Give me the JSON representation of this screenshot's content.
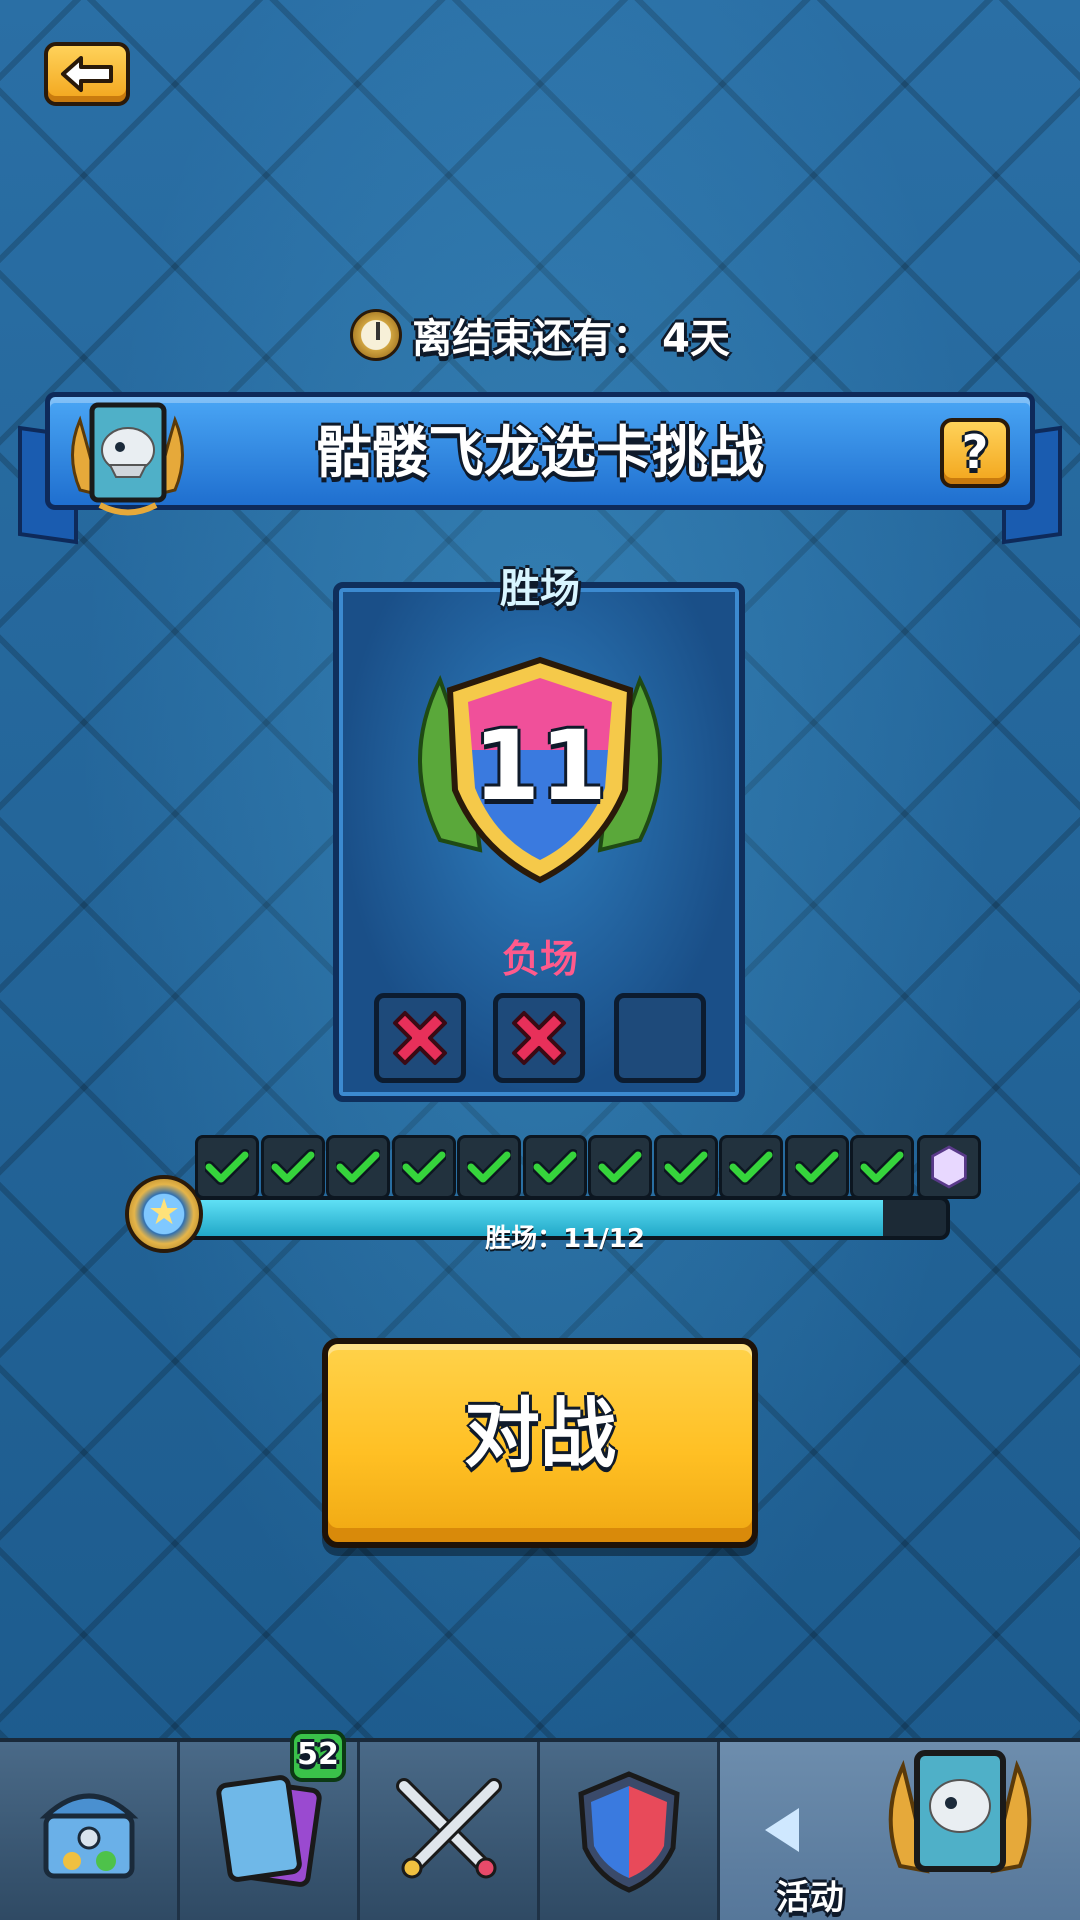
{
  "back_button": {
    "icon": "back-arrow-icon"
  },
  "timer": {
    "label": "离结束还有：",
    "value": "4天"
  },
  "challenge": {
    "title": "骷髅飞龙选卡挑战",
    "help": "?"
  },
  "wins": {
    "label": "胜场",
    "count": "11"
  },
  "losses": {
    "label": "负场",
    "slots": [
      "lost",
      "lost",
      "empty"
    ]
  },
  "progress": {
    "label": "胜场：11/12",
    "current": 11,
    "max": 12,
    "checks": 11
  },
  "battle": {
    "label": "对战"
  },
  "nav": {
    "items": [
      "chest-icon",
      "cards-icon",
      "crossed-swords-icon",
      "clan-wars-icon"
    ],
    "cards_badge": "52",
    "active_label": "活动"
  },
  "colors": {
    "accent": "#ffc024",
    "ribbon": "#2a7ad8",
    "win_check": "#36d43c",
    "loss_x": "#e8305a"
  }
}
